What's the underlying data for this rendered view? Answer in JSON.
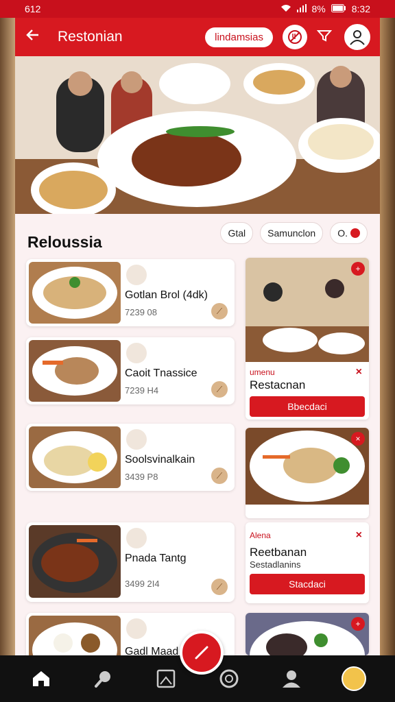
{
  "status_bar": {
    "left_text": "612",
    "battery": "8%",
    "time": "8:32"
  },
  "app_bar": {
    "title": "Restonian",
    "pill": "lindamsias"
  },
  "section": {
    "title": "Reloussia",
    "chips": [
      "Gtal",
      "Samunclon",
      "O."
    ]
  },
  "list_items": [
    {
      "name": "Gotlan Brol (4dk)",
      "meta": "7239 08"
    },
    {
      "name": "Caoit Tnassice",
      "meta": "7239 H4"
    },
    {
      "name": "Soolsvinalkain",
      "meta": "3439 P8"
    },
    {
      "name": "Pnada Tantg",
      "meta": "3499 2I4"
    },
    {
      "name": "Gadl Maad",
      "meta": ""
    }
  ],
  "right_cards": [
    {
      "tag": "umenu",
      "title": "Restacnan",
      "subtitle": "",
      "button": "Bbecdaci"
    },
    {
      "tag": "",
      "title": "",
      "subtitle": "",
      "button": ""
    },
    {
      "tag": "Alena",
      "title": "Reetbanan",
      "subtitle": "Sestadlanins",
      "button": "Stacdaci"
    }
  ],
  "colors": {
    "brand": "#d71920",
    "panel": "#fbf1f2"
  },
  "icons": [
    "back-icon",
    "no-food-icon",
    "filter-icon",
    "profile-icon",
    "home-icon",
    "search-icon",
    "image-icon",
    "scan-icon",
    "user-icon",
    "edit-icon"
  ]
}
